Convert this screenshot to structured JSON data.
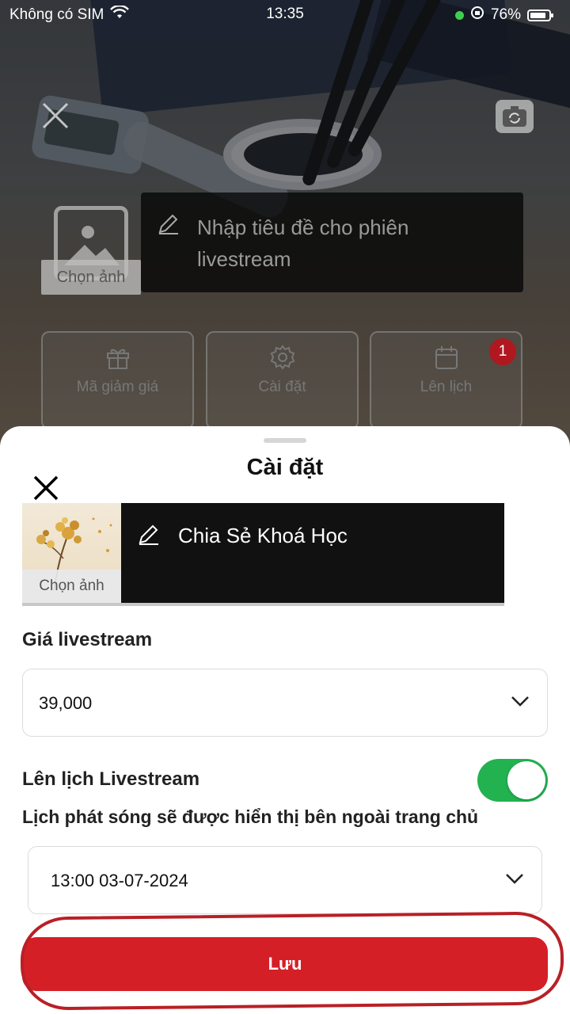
{
  "status_bar": {
    "carrier": "Không có SIM",
    "time": "13:35",
    "battery_percent": "76%"
  },
  "camera": {
    "cover_label": "Chọn ảnh",
    "title_placeholder": "Nhập tiêu đề cho phiên livestream",
    "actions": [
      {
        "label": "Mã giảm giá",
        "icon": "gift-icon"
      },
      {
        "label": "Cài đặt",
        "icon": "gear-icon"
      },
      {
        "label": "Lên lịch",
        "icon": "calendar-icon"
      }
    ],
    "schedule_badge": "1"
  },
  "sheet": {
    "title": "Cài đặt",
    "cover_label": "Chọn ảnh",
    "stream_title": "Chia Sẻ Khoá Học",
    "price_label": "Giá livestream",
    "price_value": "39,000",
    "schedule_label": "Lên lịch Livestream",
    "schedule_enabled": true,
    "schedule_note": "Lịch phát sóng sẽ được hiển thị bên ngoài trang chủ",
    "schedule_value": "13:00 03-07-2024",
    "save_label": "Lưu"
  },
  "colors": {
    "primary_red": "#d51f27",
    "toggle_green": "#22b250",
    "badge_red": "#b01820"
  }
}
